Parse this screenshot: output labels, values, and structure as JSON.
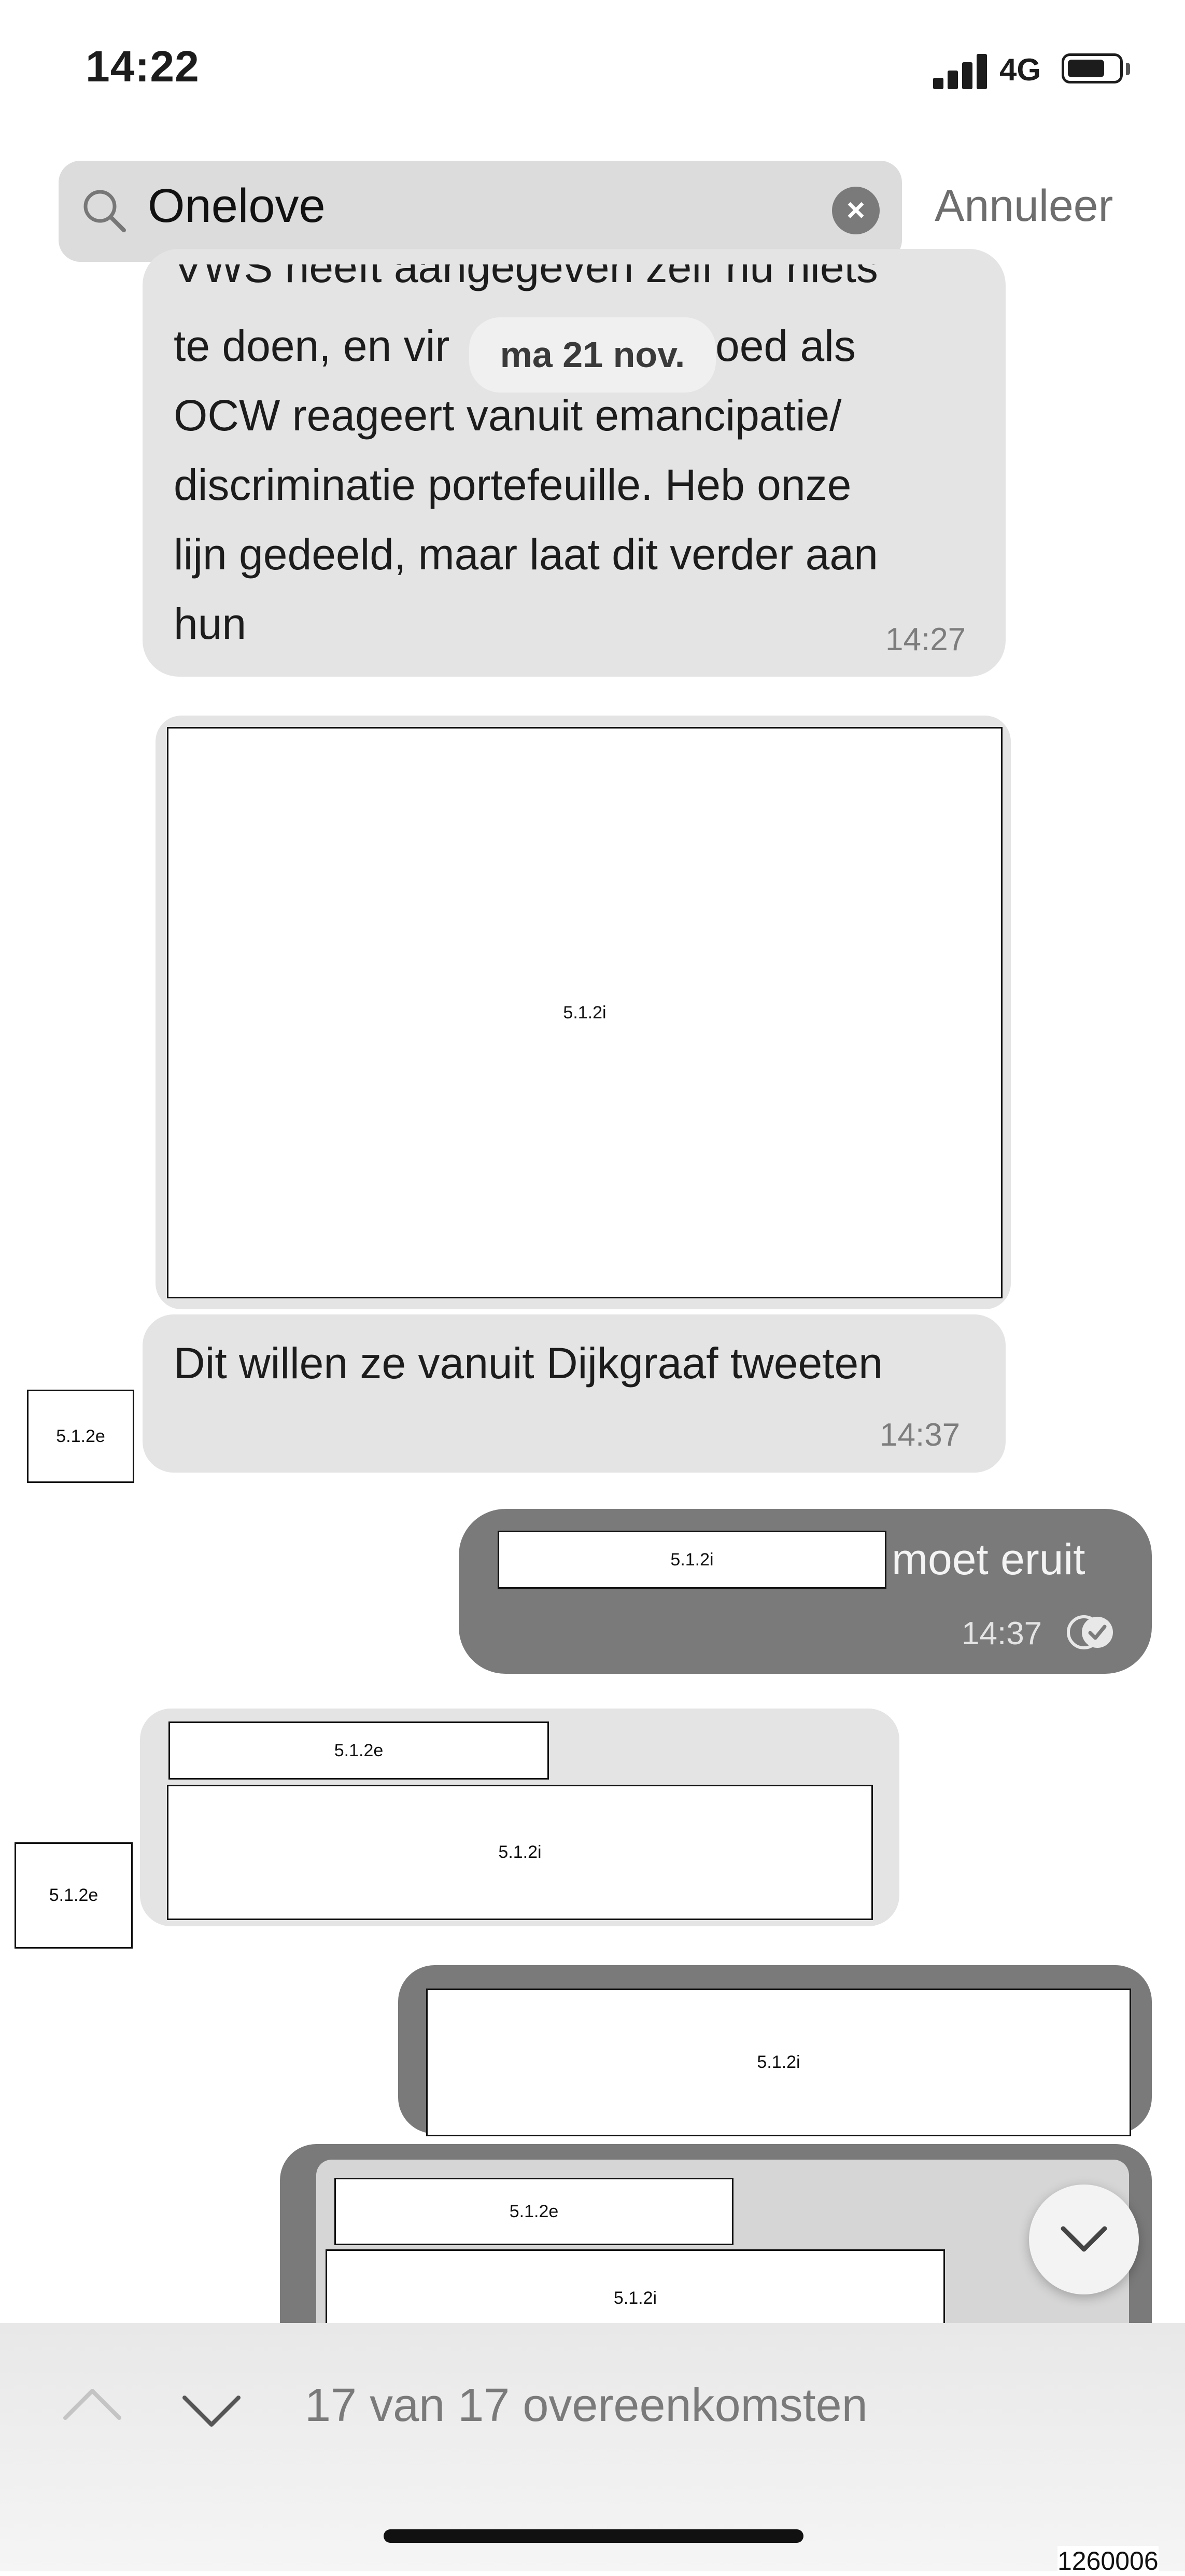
{
  "status_bar": {
    "time": "14:22",
    "network": "4G"
  },
  "search": {
    "query": "Onelove",
    "cancel_label": "Annuleer"
  },
  "date_separator": "ma 21 nov.",
  "messages": [
    {
      "lines": [
        "VWS heeft aangegeven zelf nu niets",
        "te doen, en vir",
        "OCW reageert vanuit emancipatie/",
        "discriminatie portefeuille. Heb onze",
        "lijn gedeeld, maar laat dit verder aan",
        "hun"
      ],
      "line2_tail": "oed als",
      "time": "14:27"
    },
    {
      "image_redaction": "5.1.2i"
    },
    {
      "text": "Dit willen ze vanuit Dijkgraaf tweeten",
      "time": "14:37",
      "avatar_redaction": "5.1.2e"
    },
    {
      "redaction": "5.1.2i",
      "text": "moet eruit",
      "time": "14:37"
    },
    {
      "name_redaction": "5.1.2e",
      "body_redaction": "5.1.2i",
      "avatar_redaction": "5.1.2e"
    },
    {
      "redaction": "5.1.2i"
    },
    {
      "name_redaction": "5.1.2e",
      "body_redaction": "5.1.2i"
    }
  ],
  "footer": {
    "matches": "17 van 17 overeenkomsten"
  },
  "document_number": "1260006"
}
